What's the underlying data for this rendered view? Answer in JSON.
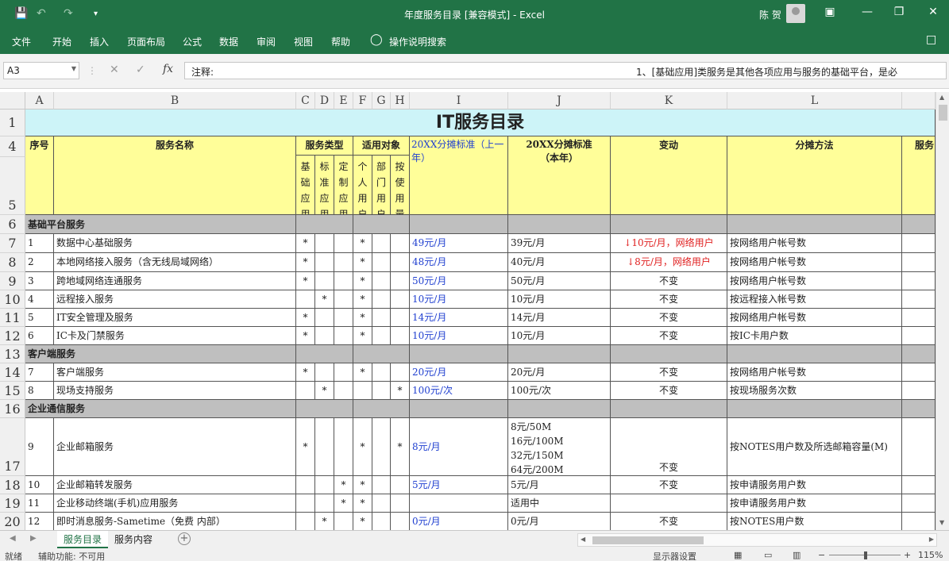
{
  "titlebar": {
    "title": "年度服务目录 [兼容模式] - Excel",
    "user": "陈 贺",
    "accent": "#217346"
  },
  "ribbon": {
    "tabs": [
      "文件",
      "开始",
      "插入",
      "页面布局",
      "公式",
      "数据",
      "审阅",
      "视图",
      "帮助"
    ],
    "search": "操作说明搜索"
  },
  "formula_bar": {
    "name_box": "A3",
    "content": "注释:",
    "content_right": "1、[基础应用]类服务是其他各项应用与服务的基础平台，是必"
  },
  "sheet": {
    "columns": [
      "A",
      "B",
      "C",
      "D",
      "E",
      "F",
      "G",
      "H",
      "I",
      "J",
      "K",
      "L"
    ],
    "title": "IT服务目录",
    "header": {
      "seq": "序号",
      "name": "服务名称",
      "type": "服务类型",
      "target": "适用对象",
      "sub_basic": "基础应用",
      "sub_standard": "标准应用",
      "sub_custom": "定制应用",
      "sub_personal": "个人用户",
      "sub_dept": "部门用户",
      "sub_usage": "按使用量",
      "prev_std": "20XX分摊标准（上一年）",
      "cur_std_1": "20XX分摊标准",
      "cur_std_2": "（本年）",
      "change": "变动",
      "method": "分摊方法",
      "more": "服务"
    },
    "sections": {
      "base": "基础平台服务",
      "client": "客户端服务",
      "comm": "企业通信服务"
    },
    "rows": [
      {
        "n": "1",
        "name": "数据中心基础服务",
        "c": "*",
        "d": "",
        "e": "",
        "f": "*",
        "g": "",
        "h": "",
        "prev": "49元/月",
        "cur": "39元/月",
        "change": "↓10元/月，网络用户",
        "method": "按网络用户帐号数"
      },
      {
        "n": "2",
        "name": "本地网络接入服务（含无线局域网络）",
        "c": "*",
        "d": "",
        "e": "",
        "f": "*",
        "g": "",
        "h": "",
        "prev": "48元/月",
        "cur": "40元/月",
        "change": "↓8元/月，网络用户",
        "method": "按网络用户帐号数"
      },
      {
        "n": "3",
        "name": "跨地域网络连通服务",
        "c": "*",
        "d": "",
        "e": "",
        "f": "*",
        "g": "",
        "h": "",
        "prev": "50元/月",
        "cur": "50元/月",
        "change": "不变",
        "method": "按网络用户帐号数"
      },
      {
        "n": "4",
        "name": "远程接入服务",
        "c": "",
        "d": "*",
        "e": "",
        "f": "*",
        "g": "",
        "h": "",
        "prev": "10元/月",
        "cur": "10元/月",
        "change": "不变",
        "method": "按远程接入帐号数"
      },
      {
        "n": "5",
        "name": "IT安全管理及服务",
        "c": "*",
        "d": "",
        "e": "",
        "f": "*",
        "g": "",
        "h": "",
        "prev": "14元/月",
        "cur": "14元/月",
        "change": "不变",
        "method": "按网络用户帐号数"
      },
      {
        "n": "6",
        "name": "IC卡及门禁服务",
        "c": "*",
        "d": "",
        "e": "",
        "f": "*",
        "g": "",
        "h": "",
        "prev": "10元/月",
        "cur": "10元/月",
        "change": "不变",
        "method": "按IC卡用户数"
      },
      {
        "n": "7",
        "name": "客户端服务",
        "c": "*",
        "d": "",
        "e": "",
        "f": "*",
        "g": "",
        "h": "",
        "prev": "20元/月",
        "cur": "20元/月",
        "change": "不变",
        "method": "按网络用户帐号数"
      },
      {
        "n": "8",
        "name": "现场支持服务",
        "c": "",
        "d": "*",
        "e": "",
        "f": "",
        "g": "",
        "h": "*",
        "prev": "100元/次",
        "cur": "100元/次",
        "change": "不变",
        "method": "按现场服务次数"
      },
      {
        "n": "9",
        "name": "企业邮箱服务",
        "c": "*",
        "d": "",
        "e": "",
        "f": "*",
        "g": "",
        "h": "*",
        "prev": "8元/月",
        "cur_lines": [
          "8元/50M",
          "16元/100M",
          "32元/150M",
          "64元/200M"
        ],
        "change": "不变",
        "method": "按NOTES用户数及所选邮箱容量(M)"
      },
      {
        "n": "10",
        "name": "企业邮箱转发服务",
        "c": "",
        "d": "",
        "e": "*",
        "f": "*",
        "g": "",
        "h": "",
        "prev": "5元/月",
        "cur": "5元/月",
        "change": "不变",
        "method": "按申请服务用户数"
      },
      {
        "n": "11",
        "name": "企业移动终端(手机)应用服务",
        "c": "",
        "d": "",
        "e": "*",
        "f": "*",
        "g": "",
        "h": "",
        "prev": "",
        "cur": "适用中",
        "change": "",
        "method": "按申请服务用户数"
      },
      {
        "n": "12",
        "name": "即时消息服务-Sametime（免费 内部）",
        "c": "",
        "d": "*",
        "e": "",
        "f": "*",
        "g": "",
        "h": "",
        "prev": "0元/月",
        "cur": "0元/月",
        "change": "不变",
        "method": "按NOTES用户数"
      }
    ],
    "row_numbers": [
      "1",
      "4",
      "5",
      "6",
      "7",
      "8",
      "9",
      "10",
      "11",
      "12",
      "13",
      "14",
      "15",
      "16",
      "17",
      "18",
      "19",
      "20"
    ]
  },
  "sheet_tabs": [
    "服务目录",
    "服务内容"
  ],
  "status": {
    "ready": "就绪",
    "accessibility": "辅助功能: 不可用",
    "display": "显示器设置",
    "zoom": "115%"
  }
}
